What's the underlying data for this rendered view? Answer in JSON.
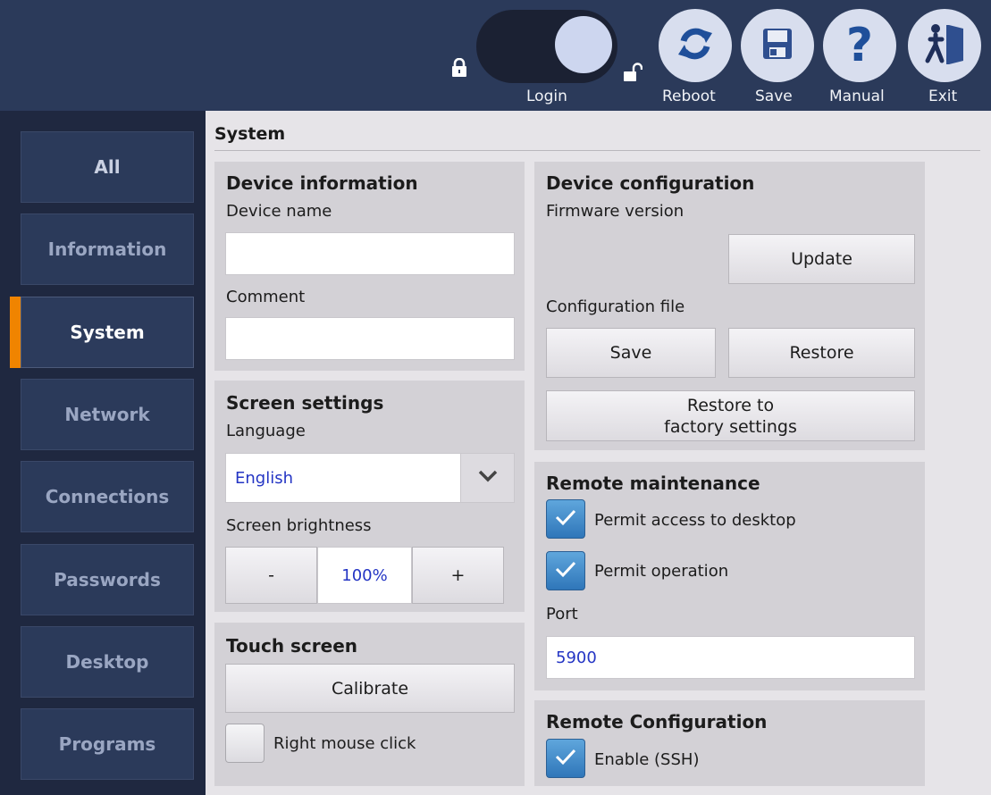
{
  "toolbar": {
    "login_label": "Login",
    "reboot_label": "Reboot",
    "save_label": "Save",
    "manual_label": "Manual",
    "exit_label": "Exit",
    "login_toggle_on": true
  },
  "sidebar": {
    "items": [
      {
        "label": "All"
      },
      {
        "label": "Information"
      },
      {
        "label": "System"
      },
      {
        "label": "Network"
      },
      {
        "label": "Connections"
      },
      {
        "label": "Passwords"
      },
      {
        "label": "Desktop"
      },
      {
        "label": "Programs"
      }
    ],
    "active": "System",
    "accent_color": "#f08400"
  },
  "page": {
    "title": "System"
  },
  "device_information": {
    "title": "Device information",
    "device_name_label": "Device name",
    "device_name_value": "",
    "comment_label": "Comment",
    "comment_value": ""
  },
  "screen_settings": {
    "title": "Screen settings",
    "language_label": "Language",
    "language_value": "English",
    "brightness_label": "Screen brightness",
    "brightness_minus": "-",
    "brightness_value": "100%",
    "brightness_plus": "+"
  },
  "touch_screen": {
    "title": "Touch screen",
    "calibrate_label": "Calibrate",
    "right_click_label": "Right mouse click",
    "right_click_checked": false
  },
  "device_configuration": {
    "title": "Device configuration",
    "firmware_label": "Firmware version",
    "update_label": "Update",
    "config_file_label": "Configuration file",
    "save_label": "Save",
    "restore_label": "Restore",
    "factory_line1": "Restore to",
    "factory_line2": "factory settings"
  },
  "remote_maintenance": {
    "title": "Remote maintenance",
    "permit_desktop_label": "Permit access to desktop",
    "permit_desktop_checked": true,
    "permit_operation_label": "Permit operation",
    "permit_operation_checked": true,
    "port_label": "Port",
    "port_value": "5900"
  },
  "remote_configuration": {
    "title": "Remote Configuration",
    "ssh_label": "Enable (SSH)",
    "ssh_checked": true
  },
  "colors": {
    "value_text": "#2435c4",
    "checkbox_blue": "#3f8ccc"
  }
}
